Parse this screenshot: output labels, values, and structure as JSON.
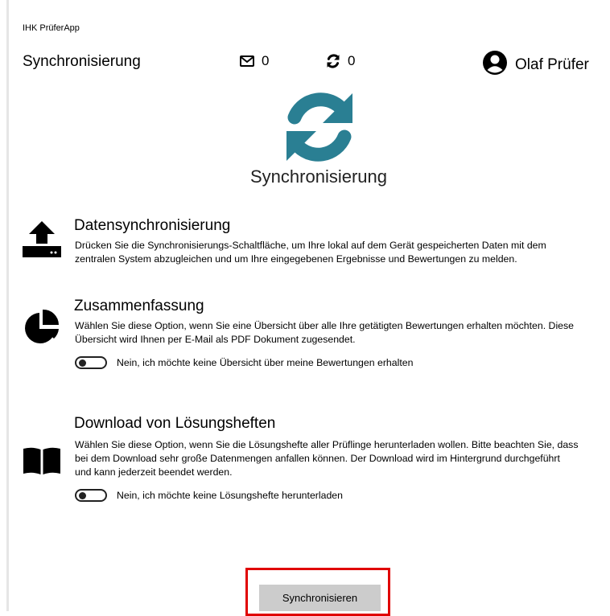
{
  "app": {
    "title": "IHK PrüferApp"
  },
  "header": {
    "title": "Synchronisierung",
    "mail_count": "0",
    "sync_count": "0",
    "user_name": "Olaf Prüfer"
  },
  "hero": {
    "title": "Synchronisierung",
    "icon": "sync-icon",
    "color": "#2a7f93"
  },
  "sections": {
    "datasync": {
      "title": "Datensynchronisierung",
      "desc_line1": "Drücken Sie die Synchronisierungs-Schaltfläche, um Ihre lokal auf dem Gerät gespeicherten Daten mit dem",
      "desc_line2": "zentralen System abzugleichen und um Ihre eingegebenen Ergebnisse und Bewertungen zu melden."
    },
    "summary": {
      "title": "Zusammenfassung",
      "desc_line1": "Wählen Sie diese Option, wenn Sie eine Übersicht über alle Ihre getätigten Bewertungen erhalten möchten. Diese",
      "desc_line2": "Übersicht wird Ihnen per E-Mail als PDF Dokument zugesendet.",
      "toggle_label": "Nein, ich möchte keine Übersicht über meine Bewertungen erhalten"
    },
    "download": {
      "title": "Download von Lösungsheften",
      "desc_line1": "Wählen Sie diese Option, wenn Sie die Lösungshefte aller Prüflinge herunterladen wollen. Bitte beachten Sie, dass",
      "desc_line2": "bei dem Download sehr große Datenmengen anfallen können. Der Download wird im Hintergrund durchgeführt",
      "desc_line3": "und kann jederzeit beendet werden.",
      "toggle_label": "Nein, ich möchte keine Lösungshefte herunterladen"
    }
  },
  "actions": {
    "sync_button": "Synchronisieren",
    "highlight_color": "#e00000"
  }
}
